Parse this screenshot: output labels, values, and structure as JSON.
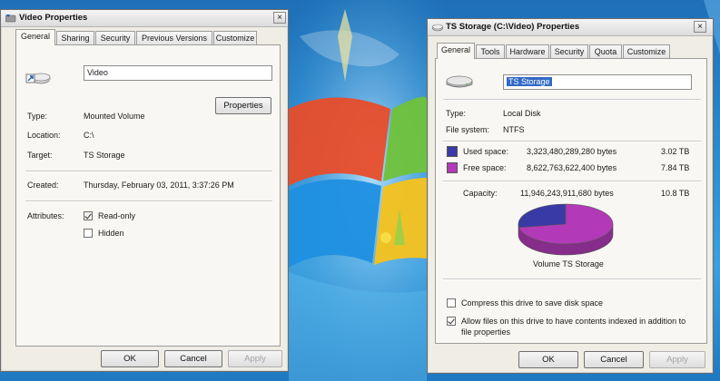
{
  "colors": {
    "used": "#3a3aa6",
    "free": "#b23ab8"
  },
  "left_dialog": {
    "title": "Video Properties",
    "close": "×",
    "tabs": [
      "General",
      "Sharing",
      "Security",
      "Previous Versions",
      "Customize"
    ],
    "name_value": "Video",
    "type_label": "Type:",
    "type_value": "Mounted Volume",
    "properties_button": "Properties",
    "location_label": "Location:",
    "location_value": "C:\\",
    "target_label": "Target:",
    "target_value": "TS Storage",
    "created_label": "Created:",
    "created_value": "Thursday, February 03, 2011, 3:37:26 PM",
    "attributes_label": "Attributes:",
    "readonly_label": "Read-only",
    "readonly_checked": true,
    "hidden_label": "Hidden",
    "hidden_checked": false,
    "buttons": {
      "ok": "OK",
      "cancel": "Cancel",
      "apply": "Apply"
    }
  },
  "right_dialog": {
    "title": "TS Storage (C:\\Video) Properties",
    "close": "×",
    "tabs": [
      "General",
      "Tools",
      "Hardware",
      "Security",
      "Quota",
      "Customize"
    ],
    "name_value": "TS Storage",
    "type_label": "Type:",
    "type_value": "Local Disk",
    "fs_label": "File system:",
    "fs_value": "NTFS",
    "used_label": "Used space:",
    "used_bytes": "3,323,480,289,280 bytes",
    "used_size": "3.02 TB",
    "free_label": "Free space:",
    "free_bytes": "8,622,763,622,400 bytes",
    "free_size": "7.84 TB",
    "capacity_label": "Capacity:",
    "capacity_bytes": "11,946,243,911,680 bytes",
    "capacity_size": "10.8 TB",
    "used_fraction": 0.278,
    "volume_label": "Volume TS Storage",
    "compress_label": "Compress this drive to save disk space",
    "compress_checked": false,
    "index_label_1": "Allow files on this drive to have contents indexed in addition to",
    "index_label_2": "file properties",
    "index_checked": true,
    "buttons": {
      "ok": "OK",
      "cancel": "Cancel",
      "apply": "Apply"
    }
  }
}
